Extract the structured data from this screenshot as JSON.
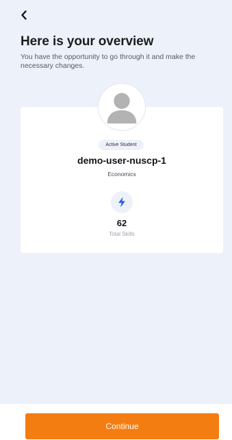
{
  "header": {
    "back_icon": "chevron-left-icon",
    "title": "Here is your overview",
    "subtitle": "You have the opportunity to go through it and make the necessary changes."
  },
  "profile": {
    "avatar_icon": "user-avatar-icon",
    "status": "Active Student",
    "username": "demo-user-nuscp-1",
    "program": "Economics"
  },
  "skills": {
    "icon": "lightning-bolt-icon",
    "count": "62",
    "label": "Total Skills"
  },
  "footer": {
    "continue_label": "Continue"
  },
  "colors": {
    "background": "#edf1f9",
    "card": "#ffffff",
    "accent": "#f47d12",
    "bolt": "#2f5fe0",
    "avatar_gray": "#b3b3b3"
  }
}
